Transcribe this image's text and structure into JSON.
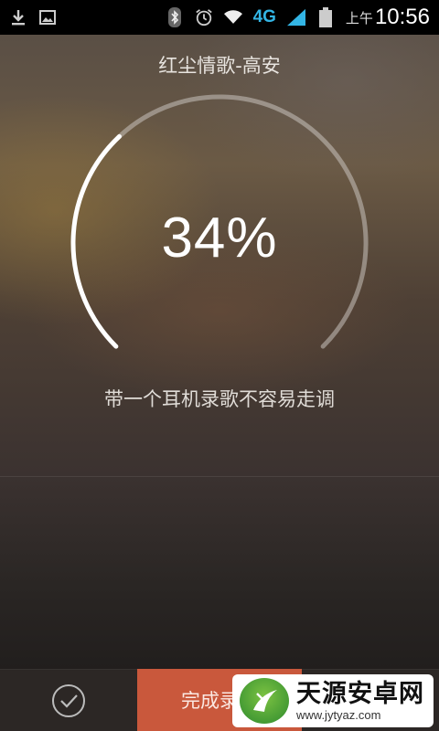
{
  "status_bar": {
    "icons_left": [
      "download-icon",
      "image-icon"
    ],
    "icons_right": [
      "bluetooth-icon",
      "alarm-icon",
      "wifi-icon",
      "signal-icon",
      "battery-icon"
    ],
    "network": "4G",
    "ampm": "上午",
    "time": "10:56"
  },
  "recording": {
    "song_title": "红尘情歌-高安",
    "progress_percent": 34,
    "percent_label": "34%",
    "tip": "带一个耳机录歌不容易走调"
  },
  "bottom_bar": {
    "confirm_icon": "check-circle-icon",
    "finish_label": "完成录制"
  },
  "watermark": {
    "name": "天源安卓网",
    "url": "www.jytyaz.com"
  },
  "colors": {
    "accent": "#c9583c",
    "network_4g": "#33b5e5"
  }
}
